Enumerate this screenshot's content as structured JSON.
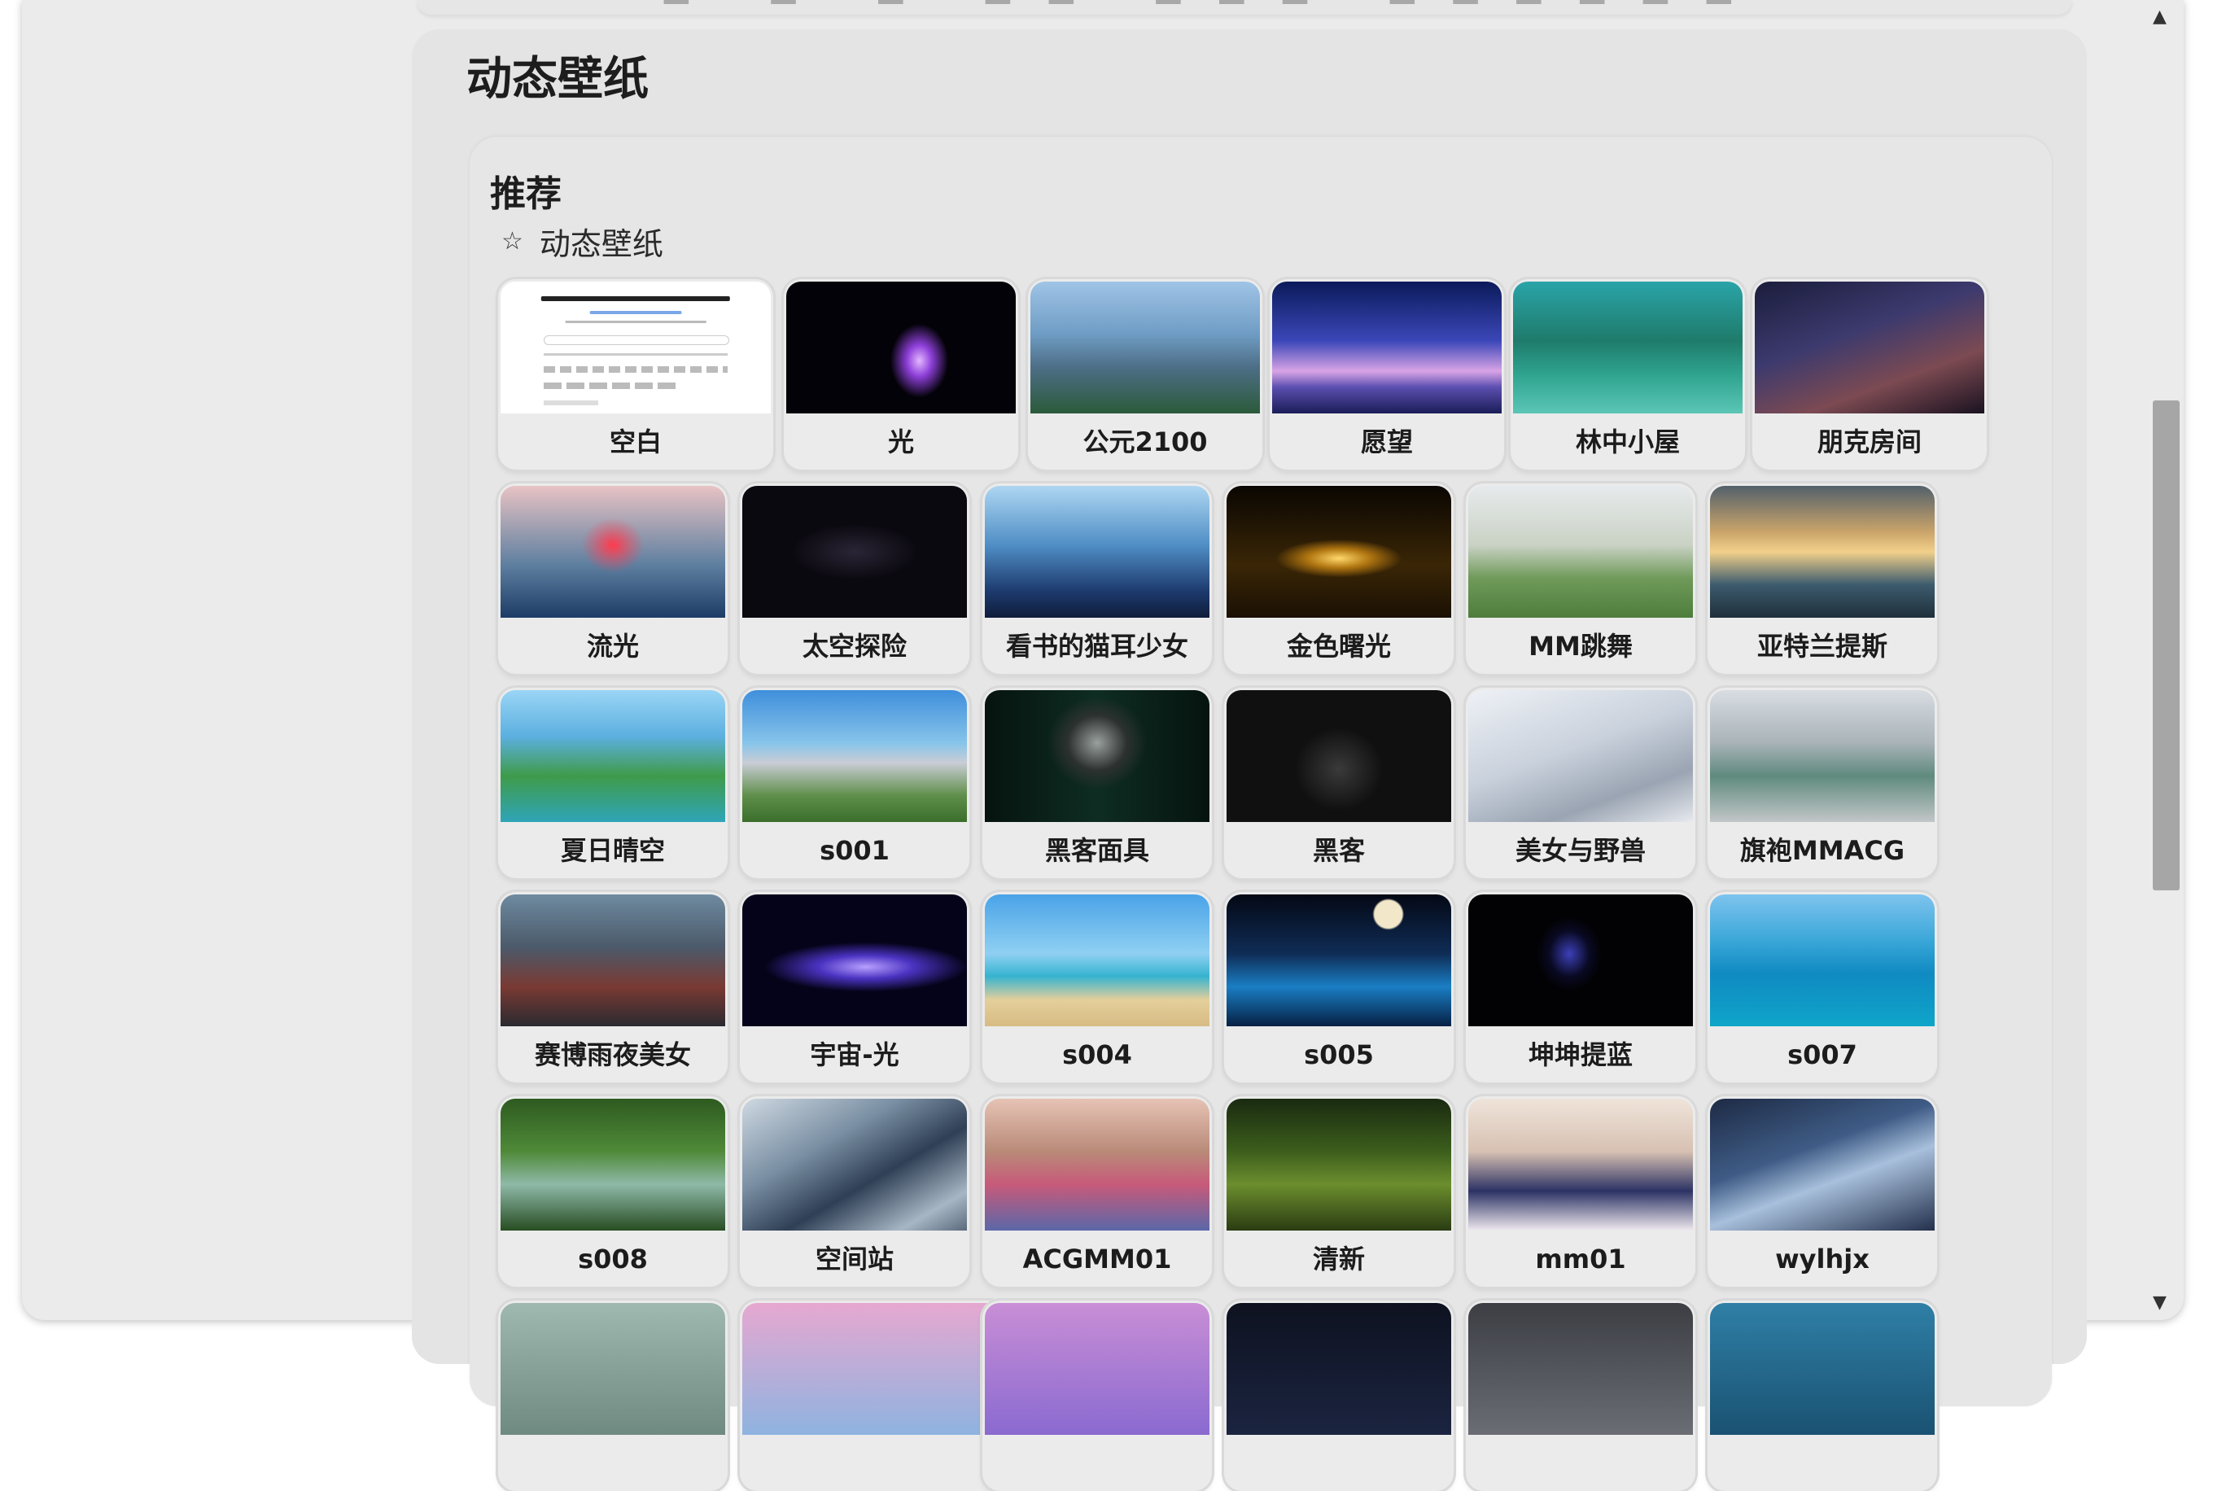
{
  "page": {
    "title": "动态壁纸",
    "section_title": "推荐",
    "category_icon": "star-outline-icon",
    "category_label": "动态壁纸"
  },
  "scrollbar": {
    "up_icon": "▲",
    "down_icon": "▼",
    "position": 0.42
  },
  "wallpapers": [
    {
      "label": "空白",
      "type": "blank"
    },
    {
      "label": "光",
      "bg": "radial-gradient(ellipse 18% 40% at 58% 60%, #e4b7ff 0%, #8d3fd8 30%, rgba(30,10,60,0) 70%), #030208"
    },
    {
      "label": "公元2100",
      "bg": "linear-gradient(180deg,#9fc4e6 0%,#6f9cc4 40%,#4d6e86 65%,#2b5a3a 100%)"
    },
    {
      "label": "愿望",
      "bg": "linear-gradient(180deg,#0b1a5a 0%,#3b47b8 45%,#d9a4e6 68%,#5c4fb0 80%,#1a1d57 100%)"
    },
    {
      "label": "林中小屋",
      "bg": "linear-gradient(180deg,#2aa4a8 0%,#1f7b6b 45%,#2ea38e 70%,#5bc6b6 100%)"
    },
    {
      "label": "朋克房间",
      "bg": "linear-gradient(160deg,#1b1d3c 0%,#3c3a6e 40%,#7c4a52 70%,#1a1220 100%)"
    },
    {
      "label": "流光",
      "bg": "radial-gradient(ellipse 20% 30% at 50% 45%, #ff3b4e 0%, rgba(255,60,80,0.4) 40%, rgba(0,0,0,0) 70%), linear-gradient(180deg,#e8c3c4 0%,#5e7fa0 60%,#1d3c66 100%)"
    },
    {
      "label": "太空探险",
      "bg": "radial-gradient(ellipse 40% 30% at 50% 50%, #2a2536 0%, #0b0910 70%), #07060a"
    },
    {
      "label": "看书的猫耳少女",
      "bg": "linear-gradient(180deg,#aed6f2 0%,#4f8ec5 45%,#1d3a6e 80%,#0f1d3a 100%)"
    },
    {
      "label": "金色曙光",
      "bg": "radial-gradient(ellipse 35% 18% at 50% 55%, #ffd86a 0%, #b07510 40%, rgba(0,0,0,0) 80%), linear-gradient(180deg,#0a0602 0%,#3a2606 60%,#1a1003 100%)"
    },
    {
      "label": "MM跳舞",
      "bg": "linear-gradient(180deg,#e7eaed 0%,#c9d2c4 45%,#6f9a5a 70%,#4e7d3c 100%)"
    },
    {
      "label": "亚特兰提斯",
      "bg": "linear-gradient(180deg,#53606b 0%,#caa46a 35%,#f2d08a 50%,#3c5b6e 75%,#1f2f3a 100%)"
    },
    {
      "label": "夏日晴空",
      "bg": "linear-gradient(180deg,#9ad5f5 0%,#5cb0e0 35%,#3f9b4a 65%,#2fa5b8 100%)"
    },
    {
      "label": "s001",
      "bg": "linear-gradient(180deg,#3f8fdc 0%,#86c4ea 40%,#c9cdd6 55%,#5f8f4a 80%,#3a6e2b 100%)"
    },
    {
      "label": "黑客面具",
      "bg": "radial-gradient(ellipse 22% 35% at 50% 40%, #9aa09e 0%, #2c3130 60%, rgba(0,0,0,0) 100%), linear-gradient(90deg,#06130f 0%,#0e2d22 50%,#06130f 100%)"
    },
    {
      "label": "黑客",
      "bg": "radial-gradient(ellipse 28% 45% at 50% 60%, #3a3a3a 0%, #101010 70%), linear-gradient(90deg,#0a1c14 0%,#07100c 50%,#0a1c14 100%)"
    },
    {
      "label": "美女与野兽",
      "bg": "linear-gradient(160deg,#eef1f6 0%,#c9d1dc 45%,#9aa4b2 75%,#e6e9ee 100%)"
    },
    {
      "label": "旗袍MMACG",
      "bg": "linear-gradient(180deg,#d8dde2 0%,#a9b3b8 40%,#5f8a7e 65%,#c2c6c8 100%)"
    },
    {
      "label": "赛博雨夜美女",
      "bg": "linear-gradient(180deg,#6f8aa0 0%,#4b5a6a 40%,#7a3a33 70%,#2a2a30 100%)"
    },
    {
      "label": "宇宙-光",
      "bg": "radial-gradient(ellipse 60% 25% at 55% 55%, #b8a0ff 0%, #4b33c2 35%, rgba(0,0,0,0) 75%), #05031a"
    },
    {
      "label": "s004",
      "bg": "linear-gradient(180deg,#4aa3e8 0%,#8fd0f2 45%,#35b3d0 62%,#e4cf9b 80%,#d7bb84 100%)"
    },
    {
      "label": "s005",
      "bg": "radial-gradient(circle at 72% 15%, #f2e7c9 0 7%, rgba(0,0,0,0) 8%), linear-gradient(180deg,#040814 0%,#0f2c56 45%,#1a7ec4 70%,#062044 100%)"
    },
    {
      "label": "坤坤提蓝",
      "bg": "radial-gradient(ellipse 18% 35% at 45% 45%, #3c40b8 0%, rgba(20,20,80,0.4) 50%, rgba(0,0,0,0) 80%), #020205"
    },
    {
      "label": "s007",
      "bg": "linear-gradient(180deg,#7ec3ef 0%,#3aa7d8 35%,#0f8ac2 60%,#0fa5c9 100%)"
    },
    {
      "label": "s008",
      "bg": "linear-gradient(180deg,#2e5a20 0%,#4f8a38 40%,#8fb9a8 65%,#274d22 100%)"
    },
    {
      "label": "空间站",
      "bg": "linear-gradient(150deg,#cfd9e2 0%,#7a8fa3 35%,#2f3f55 60%,#a7b6c4 85%,#5a6a7c 100%)"
    },
    {
      "label": "ACGMM01",
      "bg": "linear-gradient(180deg,#e6c3b5 0%,#b98a78 40%,#c75a7a 65%,#5b67a8 100%)"
    },
    {
      "label": "清新",
      "bg": "linear-gradient(180deg,#1a2a10 0%,#3c5e1c 40%,#6c8e2e 65%,#2a3c12 100%)"
    },
    {
      "label": "mm01",
      "bg": "linear-gradient(180deg,#efe4da 0%,#d7c1b2 40%,#2c3264 70%,#efe9ef 100%)"
    },
    {
      "label": "wylhjx",
      "bg": "linear-gradient(160deg,#1d2a44 0%,#3f5c86 40%,#a8c0dc 60%,#23304c 100%)"
    },
    {
      "label": "",
      "bg": "linear-gradient(180deg,#9fb8b0 0%,#6f8a80 100%)"
    },
    {
      "label": "",
      "bg": "linear-gradient(180deg,#e6a8d0 0%,#8fb3e0 100%)"
    },
    {
      "label": "",
      "bg": "linear-gradient(180deg,#c98ed6 0%,#8a6ad0 100%)"
    },
    {
      "label": "",
      "bg": "linear-gradient(180deg,#0e1220 0%,#1b2440 100%)"
    },
    {
      "label": "",
      "bg": "linear-gradient(180deg,#3c3e44 0%,#6a6d74 100%)"
    },
    {
      "label": "",
      "bg": "linear-gradient(180deg,#2f7fa6 0%,#1a5272 100%)"
    }
  ]
}
